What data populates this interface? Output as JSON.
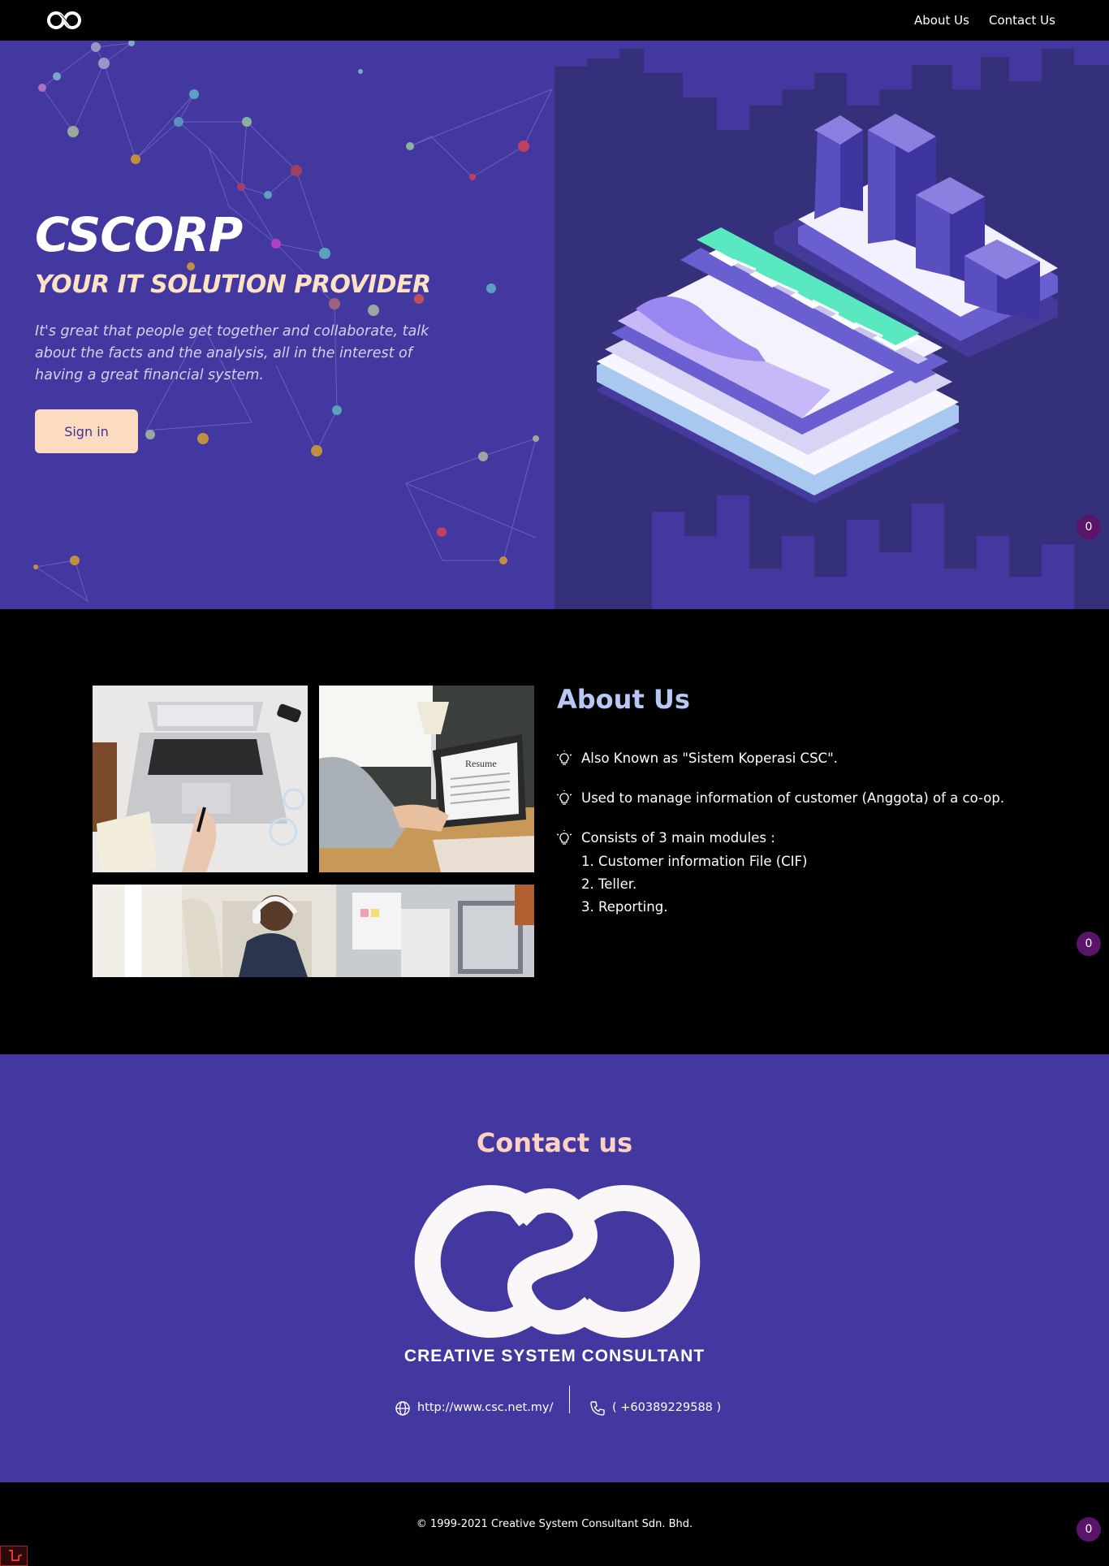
{
  "nav": {
    "logo_alt": "CSC",
    "links": [
      {
        "label": "About Us"
      },
      {
        "label": "Contact Us"
      }
    ]
  },
  "hero": {
    "title": "CSCORP",
    "subtitle": "YOUR IT SOLUTION PROVIDER",
    "description": "It's great that people get together and collaborate, talk about the facts and the analysis, all in the interest of having a great financial system.",
    "signin_label": "Sign in"
  },
  "badges": [
    "0",
    "0",
    "0"
  ],
  "about": {
    "title": "About Us",
    "items": [
      {
        "text": "Also Known as \"Sistem Koperasi CSC\"."
      },
      {
        "text": "Used to manage information of customer (Anggota) of a co-op."
      },
      {
        "text": "Consists of 3 main modules :"
      }
    ],
    "modules": [
      "1. Customer information File (CIF)",
      "2. Teller.",
      "3. Reporting."
    ]
  },
  "contact": {
    "title": "Contact us",
    "company": "CREATIVE SYSTEM CONSULTANT",
    "website": "http://www.csc.net.my/",
    "phone": "( +60389229588 )"
  },
  "footer": {
    "copyright": "© 1999-2021 Creative System Consultant Sdn. Bhd."
  },
  "colors": {
    "hero_bg": "#4338a0",
    "accent_peach": "#fcdcc0",
    "about_title": "#b8c8f4",
    "badge": "#5b1568"
  }
}
